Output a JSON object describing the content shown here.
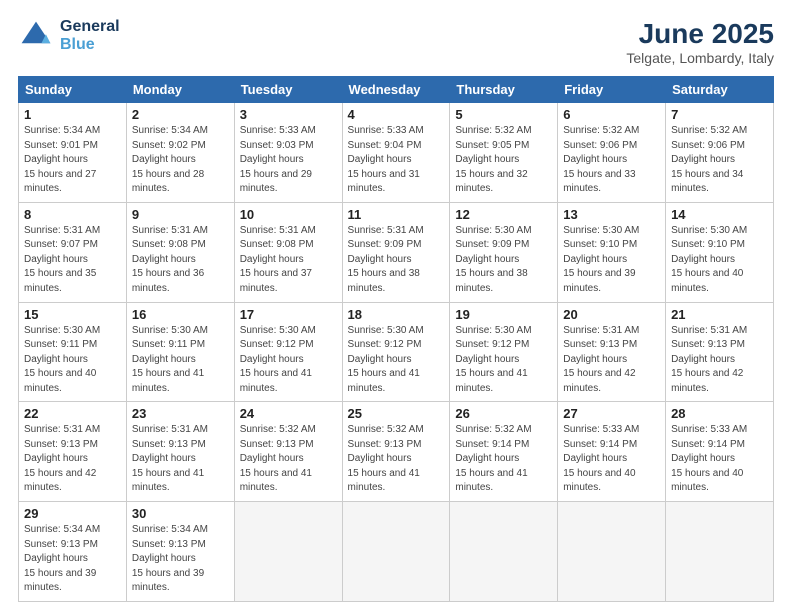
{
  "logo": {
    "line1": "General",
    "line2": "Blue"
  },
  "title": "June 2025",
  "subtitle": "Telgate, Lombardy, Italy",
  "weekdays": [
    "Sunday",
    "Monday",
    "Tuesday",
    "Wednesday",
    "Thursday",
    "Friday",
    "Saturday"
  ],
  "weeks": [
    [
      {
        "day": 1,
        "sunrise": "5:34 AM",
        "sunset": "9:01 PM",
        "daylight": "15 hours and 27 minutes."
      },
      {
        "day": 2,
        "sunrise": "5:34 AM",
        "sunset": "9:02 PM",
        "daylight": "15 hours and 28 minutes."
      },
      {
        "day": 3,
        "sunrise": "5:33 AM",
        "sunset": "9:03 PM",
        "daylight": "15 hours and 29 minutes."
      },
      {
        "day": 4,
        "sunrise": "5:33 AM",
        "sunset": "9:04 PM",
        "daylight": "15 hours and 31 minutes."
      },
      {
        "day": 5,
        "sunrise": "5:32 AM",
        "sunset": "9:05 PM",
        "daylight": "15 hours and 32 minutes."
      },
      {
        "day": 6,
        "sunrise": "5:32 AM",
        "sunset": "9:06 PM",
        "daylight": "15 hours and 33 minutes."
      },
      {
        "day": 7,
        "sunrise": "5:32 AM",
        "sunset": "9:06 PM",
        "daylight": "15 hours and 34 minutes."
      }
    ],
    [
      {
        "day": 8,
        "sunrise": "5:31 AM",
        "sunset": "9:07 PM",
        "daylight": "15 hours and 35 minutes."
      },
      {
        "day": 9,
        "sunrise": "5:31 AM",
        "sunset": "9:08 PM",
        "daylight": "15 hours and 36 minutes."
      },
      {
        "day": 10,
        "sunrise": "5:31 AM",
        "sunset": "9:08 PM",
        "daylight": "15 hours and 37 minutes."
      },
      {
        "day": 11,
        "sunrise": "5:31 AM",
        "sunset": "9:09 PM",
        "daylight": "15 hours and 38 minutes."
      },
      {
        "day": 12,
        "sunrise": "5:30 AM",
        "sunset": "9:09 PM",
        "daylight": "15 hours and 38 minutes."
      },
      {
        "day": 13,
        "sunrise": "5:30 AM",
        "sunset": "9:10 PM",
        "daylight": "15 hours and 39 minutes."
      },
      {
        "day": 14,
        "sunrise": "5:30 AM",
        "sunset": "9:10 PM",
        "daylight": "15 hours and 40 minutes."
      }
    ],
    [
      {
        "day": 15,
        "sunrise": "5:30 AM",
        "sunset": "9:11 PM",
        "daylight": "15 hours and 40 minutes."
      },
      {
        "day": 16,
        "sunrise": "5:30 AM",
        "sunset": "9:11 PM",
        "daylight": "15 hours and 41 minutes."
      },
      {
        "day": 17,
        "sunrise": "5:30 AM",
        "sunset": "9:12 PM",
        "daylight": "15 hours and 41 minutes."
      },
      {
        "day": 18,
        "sunrise": "5:30 AM",
        "sunset": "9:12 PM",
        "daylight": "15 hours and 41 minutes."
      },
      {
        "day": 19,
        "sunrise": "5:30 AM",
        "sunset": "9:12 PM",
        "daylight": "15 hours and 41 minutes."
      },
      {
        "day": 20,
        "sunrise": "5:31 AM",
        "sunset": "9:13 PM",
        "daylight": "15 hours and 42 minutes."
      },
      {
        "day": 21,
        "sunrise": "5:31 AM",
        "sunset": "9:13 PM",
        "daylight": "15 hours and 42 minutes."
      }
    ],
    [
      {
        "day": 22,
        "sunrise": "5:31 AM",
        "sunset": "9:13 PM",
        "daylight": "15 hours and 42 minutes."
      },
      {
        "day": 23,
        "sunrise": "5:31 AM",
        "sunset": "9:13 PM",
        "daylight": "15 hours and 41 minutes."
      },
      {
        "day": 24,
        "sunrise": "5:32 AM",
        "sunset": "9:13 PM",
        "daylight": "15 hours and 41 minutes."
      },
      {
        "day": 25,
        "sunrise": "5:32 AM",
        "sunset": "9:13 PM",
        "daylight": "15 hours and 41 minutes."
      },
      {
        "day": 26,
        "sunrise": "5:32 AM",
        "sunset": "9:14 PM",
        "daylight": "15 hours and 41 minutes."
      },
      {
        "day": 27,
        "sunrise": "5:33 AM",
        "sunset": "9:14 PM",
        "daylight": "15 hours and 40 minutes."
      },
      {
        "day": 28,
        "sunrise": "5:33 AM",
        "sunset": "9:14 PM",
        "daylight": "15 hours and 40 minutes."
      }
    ],
    [
      {
        "day": 29,
        "sunrise": "5:34 AM",
        "sunset": "9:13 PM",
        "daylight": "15 hours and 39 minutes."
      },
      {
        "day": 30,
        "sunrise": "5:34 AM",
        "sunset": "9:13 PM",
        "daylight": "15 hours and 39 minutes."
      },
      null,
      null,
      null,
      null,
      null
    ]
  ]
}
